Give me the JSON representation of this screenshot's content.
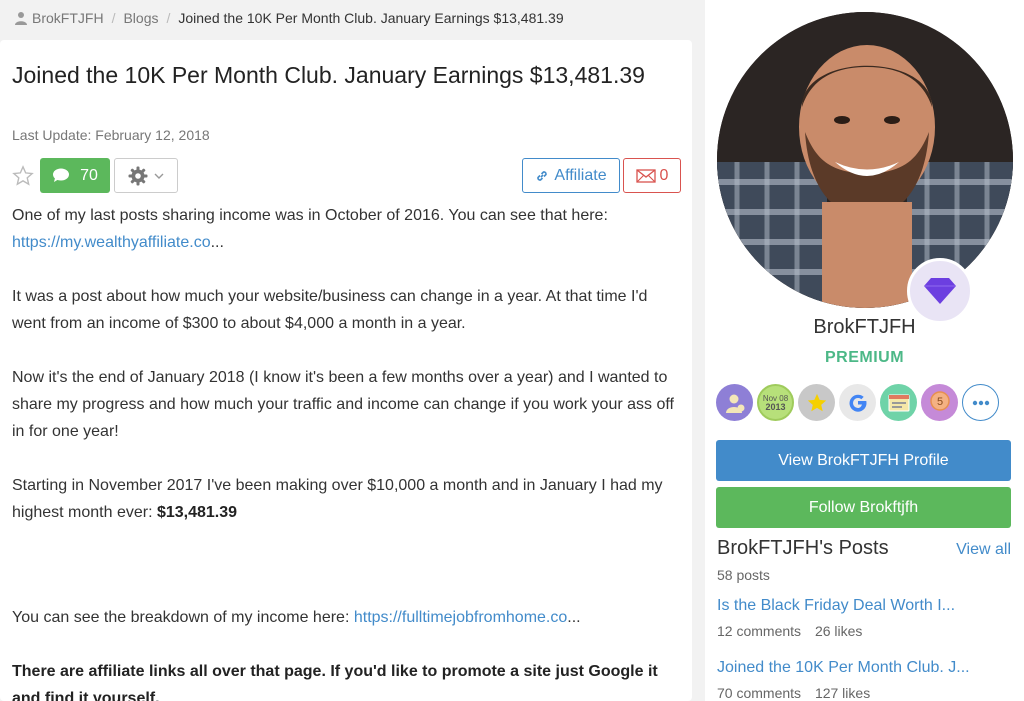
{
  "breadcrumb": {
    "user": "BrokFTJFH",
    "blogs": "Blogs",
    "current": "Joined the 10K Per Month Club. January Earnings $13,481.39"
  },
  "post": {
    "title": "Joined the 10K Per Month Club. January Earnings $13,481.39",
    "last_update": "Last Update: February 12, 2018",
    "comment_count": "70",
    "affiliate_label": "Affiliate",
    "mail_count": "0",
    "body": {
      "p1": "One of my last posts sharing income was in October of 2016. You can see that here:",
      "link1": "https://my.wealthyaffiliate.co",
      "link1_suffix": "...",
      "p2": "It was a post about how much your website/business can change in a year. At that time I'd went from an income of $300 to about $4,000 a month in a year.",
      "p3": "Now it's the end of January 2018 (I know it's been a few months over a year) and I wanted to share my progress and how much your traffic and income can change if you work your ass off in for one year!",
      "p4": "Starting in November 2017 I've been making over $10,000 a month and in January I had my highest month ever: ",
      "p4_bold": "$13,481.39",
      "p5": "You can see the breakdown of my income here: ",
      "link2": "https://fulltimejobfromhome.co",
      "link2_suffix": "...",
      "p6": "There are affiliate links all over that page. If you'd like to promote a site just Google it and find it yourself."
    }
  },
  "sidebar": {
    "name": "BrokFTJFH",
    "level": "PREMIUM",
    "badges": [
      {
        "icon": "user-gear-icon",
        "color": "#8e7fd6"
      },
      {
        "icon": "member-since-badge",
        "color": "#b7e07a",
        "line1": "Nov 08",
        "line2": "2013"
      },
      {
        "icon": "star-icon",
        "color": "#c8c8c8"
      },
      {
        "icon": "google-icon",
        "color": "#e8e8e8"
      },
      {
        "icon": "website-icon",
        "color": "#6fd3a8"
      },
      {
        "icon": "ribbon-5-icon",
        "color": "#c58ad8",
        "text": "5"
      },
      {
        "icon": "more-icon",
        "color": "#ffffff"
      }
    ],
    "view_profile": "View BrokFTJFH Profile",
    "follow": "Follow Brokftjfh",
    "posts_heading": "BrokFTJFH's Posts",
    "view_all": "View all",
    "posts_count": "58 posts",
    "posts": [
      {
        "title": "Is the Black Friday Deal Worth I...",
        "comments": "12 comments",
        "likes": "26 likes"
      },
      {
        "title": "Joined the 10K Per Month Club. J...",
        "comments": "70 comments",
        "likes": "127 likes"
      }
    ]
  },
  "colors": {
    "primary": "#428bca",
    "success": "#5cb85c",
    "danger": "#d9534f",
    "premium": "#4cb887"
  }
}
